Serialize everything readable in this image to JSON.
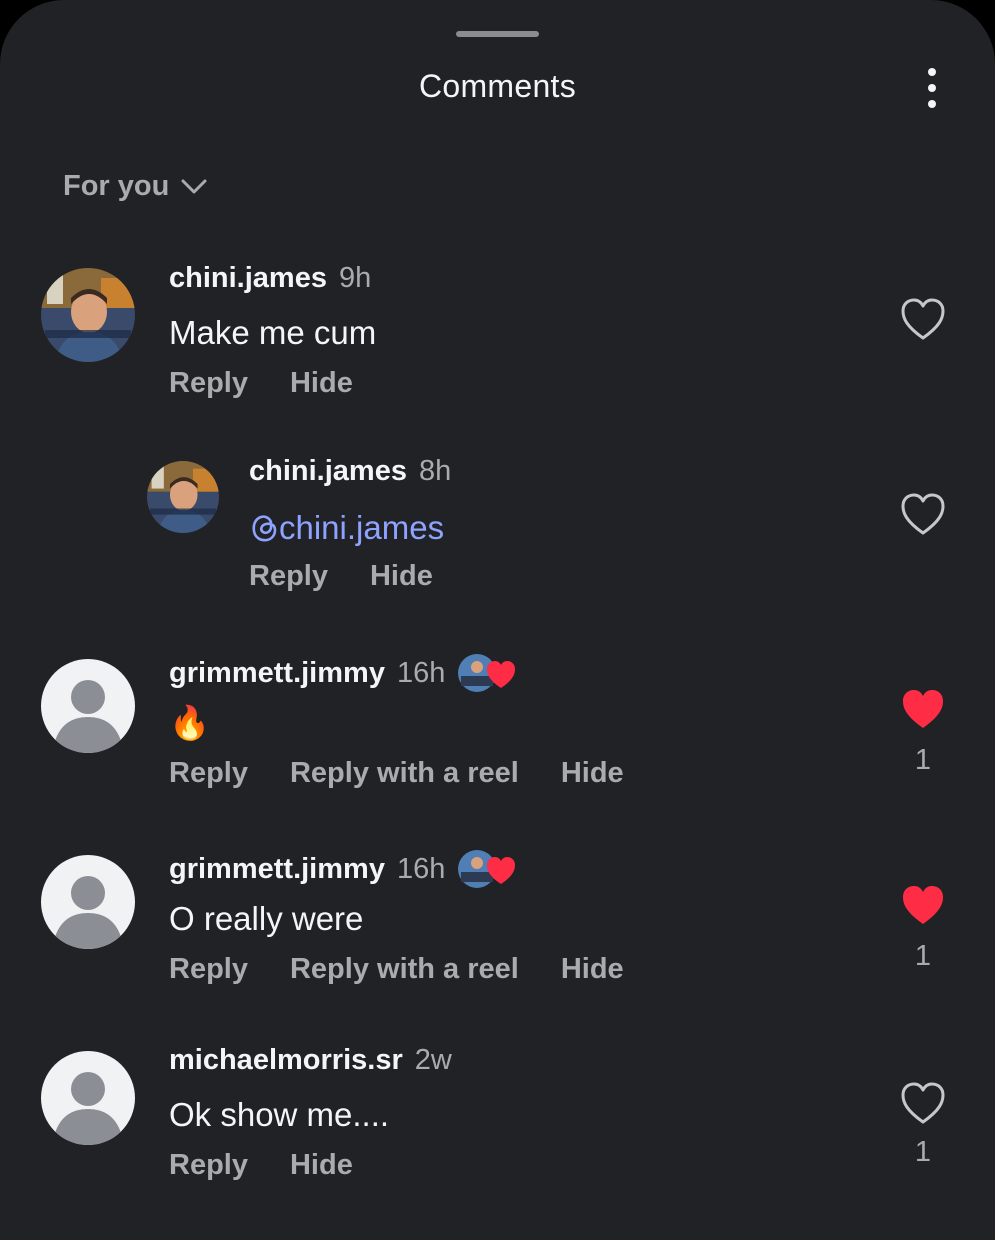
{
  "header": {
    "title": "Comments"
  },
  "filter": {
    "label": "For you"
  },
  "comments": [
    {
      "username": "chini.james",
      "time": "9h",
      "text": "Make me cum",
      "actions": [
        "Reply",
        "Hide"
      ],
      "liked": false,
      "like_count": ""
    },
    {
      "username": "chini.james",
      "time": "8h",
      "mention_icon": "threads-at-icon",
      "text": "chini.james",
      "actions": [
        "Reply",
        "Hide"
      ],
      "liked": false,
      "like_count": "",
      "is_reply": true
    },
    {
      "username": "grimmett.jimmy",
      "time": "16h",
      "text": "🔥",
      "actions": [
        "Reply",
        "Reply with a reel",
        "Hide"
      ],
      "liked": true,
      "like_count": "1",
      "creator_liked": true
    },
    {
      "username": "grimmett.jimmy",
      "time": "16h",
      "text": "O really were",
      "actions": [
        "Reply",
        "Reply with a reel",
        "Hide"
      ],
      "liked": true,
      "like_count": "1",
      "creator_liked": true
    },
    {
      "username": "michaelmorris.sr",
      "time": "2w",
      "text": "Ok show me....",
      "actions": [
        "Reply",
        "Hide"
      ],
      "liked": false,
      "like_count": "1"
    }
  ],
  "colors": {
    "background": "#212226",
    "like_red": "#fe2c45",
    "mention": "#8ea2ff",
    "muted": "#a9abb0"
  }
}
